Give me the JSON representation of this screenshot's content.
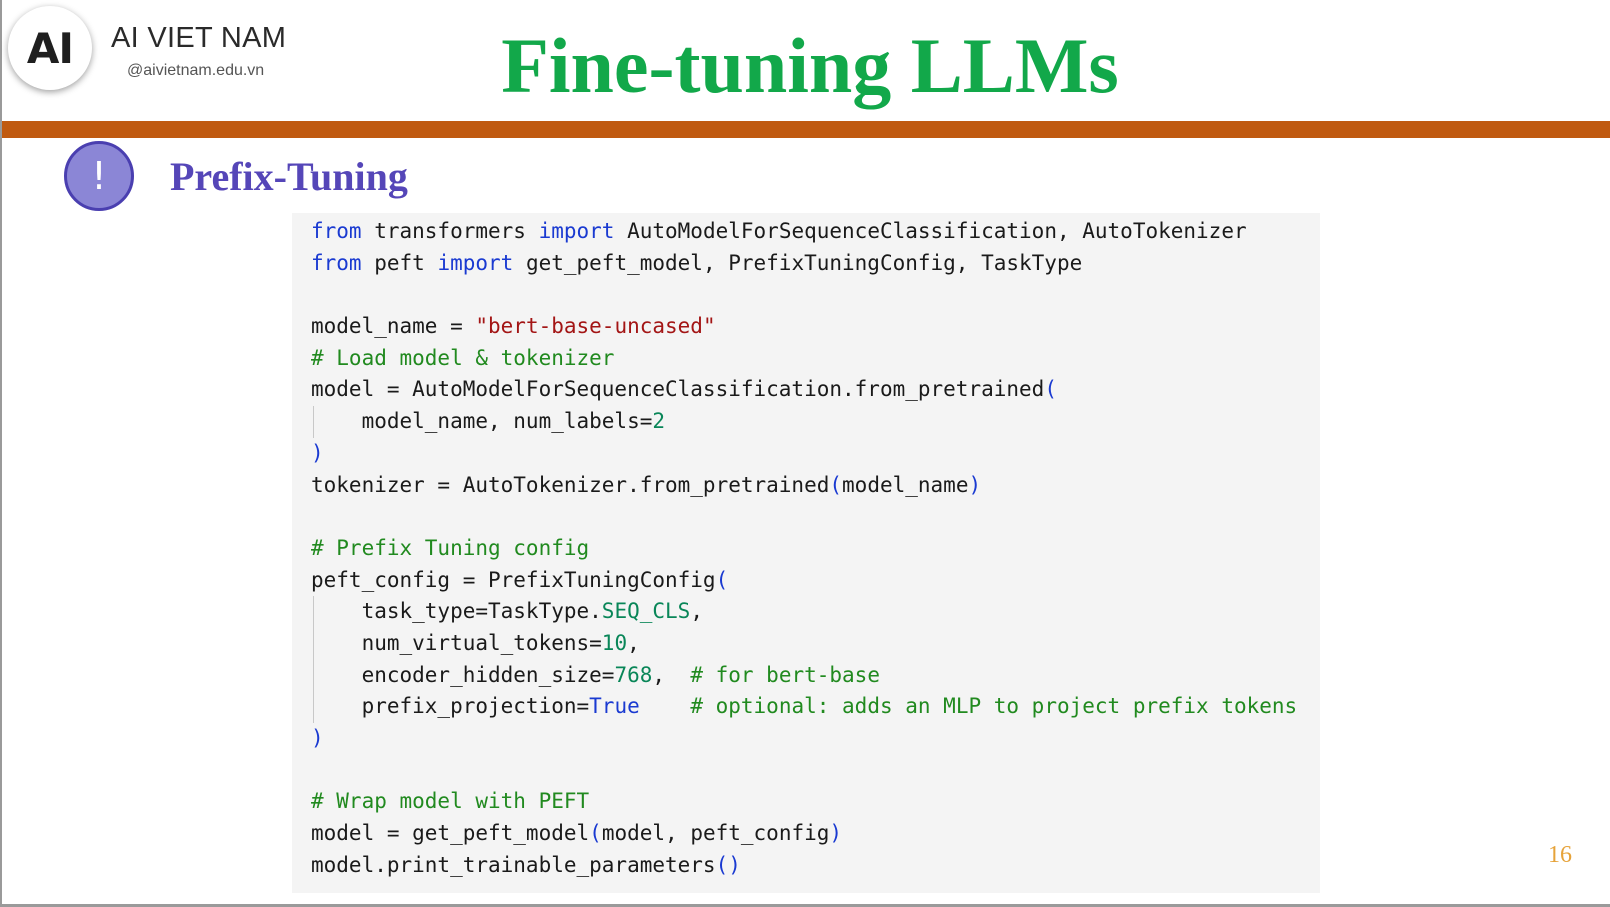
{
  "brand": {
    "logo_text": "AI",
    "name": "AI VIET NAM",
    "handle": "@aivietnam.edu.vn"
  },
  "slide": {
    "title": "Fine-tuning LLMs",
    "section_icon_text": "!",
    "section_title": "Prefix-Tuning",
    "page_number": "16"
  },
  "code": {
    "line01": [
      {
        "t": "from",
        "c": "kw"
      },
      {
        "t": " transformers ",
        "c": ""
      },
      {
        "t": "import",
        "c": "kw"
      },
      {
        "t": " AutoModelForSequenceClassification, AutoTokenizer",
        "c": ""
      }
    ],
    "line02": [
      {
        "t": "from",
        "c": "kw"
      },
      {
        "t": " peft ",
        "c": ""
      },
      {
        "t": "import",
        "c": "kw"
      },
      {
        "t": " get_peft_model, PrefixTuningConfig, TaskType",
        "c": ""
      }
    ],
    "line03": [],
    "line04": [
      {
        "t": "model_name = ",
        "c": ""
      },
      {
        "t": "\"bert-base-uncased\"",
        "c": "str"
      }
    ],
    "line05": [
      {
        "t": "# Load model & tokenizer",
        "c": "cmt"
      }
    ],
    "line06": [
      {
        "t": "model = AutoModelForSequenceClassification.from_pretrained",
        "c": ""
      },
      {
        "t": "(",
        "c": "br"
      }
    ],
    "line07": [
      {
        "t": "    model_name, num_labels=",
        "c": ""
      },
      {
        "t": "2",
        "c": "num"
      }
    ],
    "line08": [
      {
        "t": ")",
        "c": "br"
      }
    ],
    "line09": [
      {
        "t": "tokenizer = AutoTokenizer.from_pretrained",
        "c": ""
      },
      {
        "t": "(",
        "c": "br"
      },
      {
        "t": "model_name",
        "c": ""
      },
      {
        "t": ")",
        "c": "br"
      }
    ],
    "line10": [],
    "line11": [
      {
        "t": "# Prefix Tuning config",
        "c": "cmt"
      }
    ],
    "line12": [
      {
        "t": "peft_config = PrefixTuningConfig",
        "c": ""
      },
      {
        "t": "(",
        "c": "br"
      }
    ],
    "line13": [
      {
        "t": "    task_type=TaskType.",
        "c": ""
      },
      {
        "t": "SEQ_CLS",
        "c": "num"
      },
      {
        "t": ",",
        "c": ""
      }
    ],
    "line14": [
      {
        "t": "    num_virtual_tokens=",
        "c": ""
      },
      {
        "t": "10",
        "c": "num"
      },
      {
        "t": ",",
        "c": ""
      }
    ],
    "line15": [
      {
        "t": "    encoder_hidden_size=",
        "c": ""
      },
      {
        "t": "768",
        "c": "num"
      },
      {
        "t": ",  ",
        "c": ""
      },
      {
        "t": "# for bert-base",
        "c": "cmt"
      }
    ],
    "line16": [
      {
        "t": "    prefix_projection=",
        "c": ""
      },
      {
        "t": "True",
        "c": "kw"
      },
      {
        "t": "    ",
        "c": ""
      },
      {
        "t": "# optional: adds an MLP to project prefix tokens",
        "c": "cmt"
      }
    ],
    "line17": [
      {
        "t": ")",
        "c": "br"
      }
    ],
    "line18": [],
    "line19": [
      {
        "t": "# Wrap model with PEFT",
        "c": "cmt"
      }
    ],
    "line20": [
      {
        "t": "model = get_peft_model",
        "c": ""
      },
      {
        "t": "(",
        "c": "br"
      },
      {
        "t": "model, peft_config",
        "c": ""
      },
      {
        "t": ")",
        "c": "br"
      }
    ],
    "line21": [
      {
        "t": "model.print_trainable_parameters",
        "c": ""
      },
      {
        "t": "()",
        "c": "br"
      }
    ]
  },
  "colors": {
    "title_green": "#12a84a",
    "section_purple": "#5546b8",
    "divider_orange": "#c05a10",
    "keyword_blue": "#1a3ad1",
    "string_red": "#a31515",
    "comment_green": "#218a1f",
    "number_teal": "#098658",
    "page_number_gold": "#e6a33a"
  }
}
